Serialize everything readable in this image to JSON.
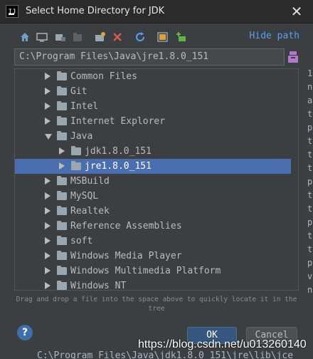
{
  "window": {
    "title": "Select Home Directory for JDK",
    "close_glyph": "✕",
    "app_icon_text": "IJ"
  },
  "toolbar": {
    "icons": [
      "home-icon",
      "desktop-icon",
      "project-icon",
      "module-icon",
      "new-folder-icon",
      "delete-icon",
      "refresh-icon",
      "show-hidden-icon",
      "new-item-icon"
    ],
    "hide_path_label": "Hide path"
  },
  "path_field": {
    "value": "C:\\Program Files\\Java\\jre1.8.0_151"
  },
  "tree": {
    "items": [
      {
        "label": "Common Files",
        "level": 0,
        "expanded": false,
        "selected": false
      },
      {
        "label": "Git",
        "level": 0,
        "expanded": false,
        "selected": false
      },
      {
        "label": "Intel",
        "level": 0,
        "expanded": false,
        "selected": false
      },
      {
        "label": "Internet Explorer",
        "level": 0,
        "expanded": false,
        "selected": false
      },
      {
        "label": "Java",
        "level": 0,
        "expanded": true,
        "selected": false
      },
      {
        "label": "jdk1.8.0_151",
        "level": 1,
        "expanded": false,
        "selected": false
      },
      {
        "label": "jre1.8.0_151",
        "level": 1,
        "expanded": false,
        "selected": true
      },
      {
        "label": "MSBuild",
        "level": 0,
        "expanded": false,
        "selected": false
      },
      {
        "label": "MySQL",
        "level": 0,
        "expanded": false,
        "selected": false
      },
      {
        "label": "Realtek",
        "level": 0,
        "expanded": false,
        "selected": false
      },
      {
        "label": "Reference Assemblies",
        "level": 0,
        "expanded": false,
        "selected": false
      },
      {
        "label": "soft",
        "level": 0,
        "expanded": false,
        "selected": false
      },
      {
        "label": "Windows Media Player",
        "level": 0,
        "expanded": false,
        "selected": false
      },
      {
        "label": "Windows Multimedia Platform",
        "level": 0,
        "expanded": false,
        "selected": false
      },
      {
        "label": "Windows NT",
        "level": 0,
        "expanded": false,
        "selected": false
      }
    ]
  },
  "hint": {
    "text": "Drag and drop a file into the space above to quickly locate it in the tree"
  },
  "buttons": {
    "help": "?",
    "ok": "OK",
    "cancel": "Cancel"
  },
  "background": {
    "right_chars": [
      "1",
      "n",
      "a",
      "t",
      "p",
      "t",
      "t",
      "t",
      "p",
      "t",
      "t",
      "p",
      "t",
      "t",
      "p",
      "v",
      "n"
    ],
    "bottom_path": "C:\\Program Files\\Java\\jdk1.8.0_151\\jre\\lib\\jce"
  },
  "watermark": "https://blog.csdn.net/u013260140",
  "colors": {
    "selection": "#4b6eaf",
    "link": "#589df6",
    "background": "#3c3f41"
  }
}
